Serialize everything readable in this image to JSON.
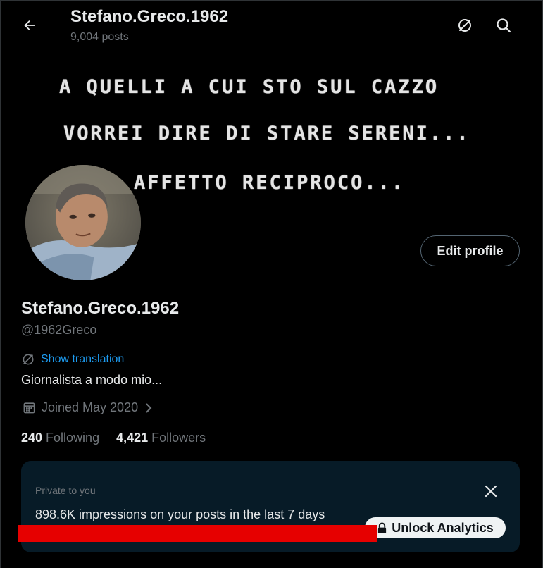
{
  "header": {
    "title": "Stefano.Greco.1962",
    "posts_count": "9,004 posts",
    "back_icon": "arrow-left-icon",
    "translate_icon": "translate-icon",
    "search_icon": "search-icon"
  },
  "banner": {
    "lines": [
      "A QUELLI A CUI STO SUL CAZZO",
      "VORREI DIRE DI STARE SERENI...",
      "AFFETTO RECIPROCO..."
    ]
  },
  "profile": {
    "display_name": "Stefano.Greco.1962",
    "handle": "@1962Greco",
    "show_translation": "Show translation",
    "bio": "Giornalista a modo mio...",
    "joined": "Joined May 2020",
    "edit_button": "Edit profile",
    "following_count": "240",
    "following_label": "Following",
    "followers_count": "4,421",
    "followers_label": "Followers"
  },
  "analytics_card": {
    "private_label": "Private to you",
    "impressions_text": "898.6K impressions on your posts in the last 7 days",
    "unlock_button": "Unlock Analytics",
    "close_icon": "close-icon",
    "lock_icon": "lock-icon"
  },
  "colors": {
    "background": "#000000",
    "text_primary": "#e7e9ea",
    "text_secondary": "#71767b",
    "link": "#1d9bf0",
    "card_bg": "#071b27",
    "redaction": "#e60000"
  }
}
